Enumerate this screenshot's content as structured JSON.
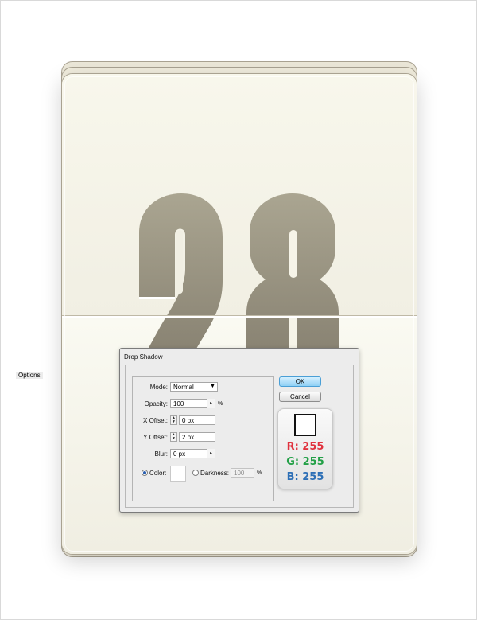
{
  "calendar": {
    "day": "28",
    "colors": {
      "digit_top": "#aaa591",
      "digit_bottom": "#878171",
      "page": "#f6f4e8"
    }
  },
  "dialog": {
    "title": "Drop Shadow",
    "group_label": "Options",
    "mode": {
      "label": "Mode:",
      "value": "Normal"
    },
    "opacity": {
      "label": "Opacity:",
      "value": "100",
      "unit": "%"
    },
    "x_offset": {
      "label": "X Offset:",
      "value": "0 px"
    },
    "y_offset": {
      "label": "Y Offset:",
      "value": "2 px"
    },
    "blur": {
      "label": "Blur:",
      "value": "0 px"
    },
    "color_option": {
      "label": "Color:",
      "selected": true,
      "swatch": "#ffffff"
    },
    "darkness_option": {
      "label": "Darkness:",
      "value": "100",
      "unit": "%",
      "selected": false
    },
    "ok_label": "OK",
    "cancel_label": "Cancel"
  },
  "color_info": {
    "swatch": "#ffffff",
    "r": "R: 255",
    "g": "G: 255",
    "b": "B: 255",
    "colors": {
      "r": "#e0323e",
      "g": "#23a047",
      "b": "#2d6fb6"
    }
  }
}
